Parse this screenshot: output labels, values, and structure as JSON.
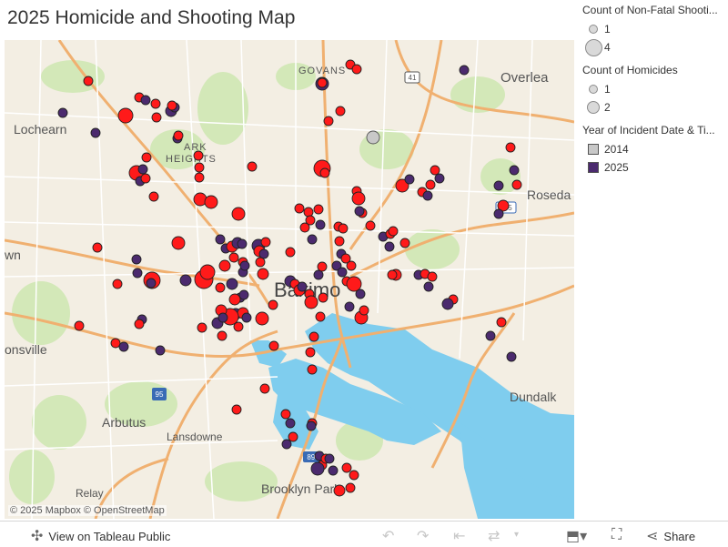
{
  "title": "2025 Homicide and Shooting Map",
  "legend": {
    "nonfatal": {
      "title": "Count of Non-Fatal Shooti...",
      "items": [
        "1",
        "4"
      ]
    },
    "homicides": {
      "title": "Count of Homicides",
      "items": [
        "1",
        "2"
      ]
    },
    "year": {
      "title": "Year of Incident Date & Ti...",
      "items": [
        {
          "label": "2014",
          "color": "#c8c8c8"
        },
        {
          "label": "2025",
          "color": "#4b2a6e"
        }
      ]
    }
  },
  "map": {
    "attribution": "© 2025 Mapbox © OpenStreetMap",
    "place_labels": [
      "GOVANS",
      "Overlea",
      "Lochearn",
      "ARK",
      "HEIGHTS",
      "Roseda",
      "wn",
      "Baltimo",
      "onsville",
      "Dundalk",
      "Arbutus",
      "Lansdowne",
      "Relay",
      "Brooklyn Park"
    ],
    "route_shields": [
      "41",
      "895",
      "95",
      "895"
    ]
  },
  "colors": {
    "shooting": "#ff1a1a",
    "homicide_2025": "#4b2a6e",
    "year_2014": "#c8c8c8",
    "water": "#7fcdee",
    "park": "#d3e8b8",
    "road": "#f0b070"
  },
  "toolbar": {
    "view_on_tableau": "View on Tableau Public",
    "share": "Share",
    "icons": [
      "tableau-icon",
      "undo-icon",
      "redo-icon",
      "revert-icon",
      "refresh-icon",
      "download-icon",
      "fullscreen-icon",
      "share-icon"
    ]
  }
}
